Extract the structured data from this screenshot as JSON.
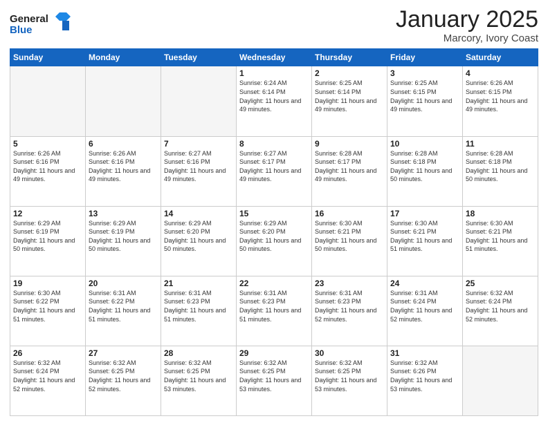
{
  "header": {
    "logo_line1": "General",
    "logo_line2": "Blue",
    "month": "January 2025",
    "location": "Marcory, Ivory Coast"
  },
  "weekdays": [
    "Sunday",
    "Monday",
    "Tuesday",
    "Wednesday",
    "Thursday",
    "Friday",
    "Saturday"
  ],
  "weeks": [
    [
      {
        "day": "",
        "info": ""
      },
      {
        "day": "",
        "info": ""
      },
      {
        "day": "",
        "info": ""
      },
      {
        "day": "1",
        "info": "Sunrise: 6:24 AM\nSunset: 6:14 PM\nDaylight: 11 hours\nand 49 minutes."
      },
      {
        "day": "2",
        "info": "Sunrise: 6:25 AM\nSunset: 6:14 PM\nDaylight: 11 hours\nand 49 minutes."
      },
      {
        "day": "3",
        "info": "Sunrise: 6:25 AM\nSunset: 6:15 PM\nDaylight: 11 hours\nand 49 minutes."
      },
      {
        "day": "4",
        "info": "Sunrise: 6:26 AM\nSunset: 6:15 PM\nDaylight: 11 hours\nand 49 minutes."
      }
    ],
    [
      {
        "day": "5",
        "info": "Sunrise: 6:26 AM\nSunset: 6:16 PM\nDaylight: 11 hours\nand 49 minutes."
      },
      {
        "day": "6",
        "info": "Sunrise: 6:26 AM\nSunset: 6:16 PM\nDaylight: 11 hours\nand 49 minutes."
      },
      {
        "day": "7",
        "info": "Sunrise: 6:27 AM\nSunset: 6:16 PM\nDaylight: 11 hours\nand 49 minutes."
      },
      {
        "day": "8",
        "info": "Sunrise: 6:27 AM\nSunset: 6:17 PM\nDaylight: 11 hours\nand 49 minutes."
      },
      {
        "day": "9",
        "info": "Sunrise: 6:28 AM\nSunset: 6:17 PM\nDaylight: 11 hours\nand 49 minutes."
      },
      {
        "day": "10",
        "info": "Sunrise: 6:28 AM\nSunset: 6:18 PM\nDaylight: 11 hours\nand 50 minutes."
      },
      {
        "day": "11",
        "info": "Sunrise: 6:28 AM\nSunset: 6:18 PM\nDaylight: 11 hours\nand 50 minutes."
      }
    ],
    [
      {
        "day": "12",
        "info": "Sunrise: 6:29 AM\nSunset: 6:19 PM\nDaylight: 11 hours\nand 50 minutes."
      },
      {
        "day": "13",
        "info": "Sunrise: 6:29 AM\nSunset: 6:19 PM\nDaylight: 11 hours\nand 50 minutes."
      },
      {
        "day": "14",
        "info": "Sunrise: 6:29 AM\nSunset: 6:20 PM\nDaylight: 11 hours\nand 50 minutes."
      },
      {
        "day": "15",
        "info": "Sunrise: 6:29 AM\nSunset: 6:20 PM\nDaylight: 11 hours\nand 50 minutes."
      },
      {
        "day": "16",
        "info": "Sunrise: 6:30 AM\nSunset: 6:21 PM\nDaylight: 11 hours\nand 50 minutes."
      },
      {
        "day": "17",
        "info": "Sunrise: 6:30 AM\nSunset: 6:21 PM\nDaylight: 11 hours\nand 51 minutes."
      },
      {
        "day": "18",
        "info": "Sunrise: 6:30 AM\nSunset: 6:21 PM\nDaylight: 11 hours\nand 51 minutes."
      }
    ],
    [
      {
        "day": "19",
        "info": "Sunrise: 6:30 AM\nSunset: 6:22 PM\nDaylight: 11 hours\nand 51 minutes."
      },
      {
        "day": "20",
        "info": "Sunrise: 6:31 AM\nSunset: 6:22 PM\nDaylight: 11 hours\nand 51 minutes."
      },
      {
        "day": "21",
        "info": "Sunrise: 6:31 AM\nSunset: 6:23 PM\nDaylight: 11 hours\nand 51 minutes."
      },
      {
        "day": "22",
        "info": "Sunrise: 6:31 AM\nSunset: 6:23 PM\nDaylight: 11 hours\nand 51 minutes."
      },
      {
        "day": "23",
        "info": "Sunrise: 6:31 AM\nSunset: 6:23 PM\nDaylight: 11 hours\nand 52 minutes."
      },
      {
        "day": "24",
        "info": "Sunrise: 6:31 AM\nSunset: 6:24 PM\nDaylight: 11 hours\nand 52 minutes."
      },
      {
        "day": "25",
        "info": "Sunrise: 6:32 AM\nSunset: 6:24 PM\nDaylight: 11 hours\nand 52 minutes."
      }
    ],
    [
      {
        "day": "26",
        "info": "Sunrise: 6:32 AM\nSunset: 6:24 PM\nDaylight: 11 hours\nand 52 minutes."
      },
      {
        "day": "27",
        "info": "Sunrise: 6:32 AM\nSunset: 6:25 PM\nDaylight: 11 hours\nand 52 minutes."
      },
      {
        "day": "28",
        "info": "Sunrise: 6:32 AM\nSunset: 6:25 PM\nDaylight: 11 hours\nand 53 minutes."
      },
      {
        "day": "29",
        "info": "Sunrise: 6:32 AM\nSunset: 6:25 PM\nDaylight: 11 hours\nand 53 minutes."
      },
      {
        "day": "30",
        "info": "Sunrise: 6:32 AM\nSunset: 6:25 PM\nDaylight: 11 hours\nand 53 minutes."
      },
      {
        "day": "31",
        "info": "Sunrise: 6:32 AM\nSunset: 6:26 PM\nDaylight: 11 hours\nand 53 minutes."
      },
      {
        "day": "",
        "info": ""
      }
    ]
  ]
}
